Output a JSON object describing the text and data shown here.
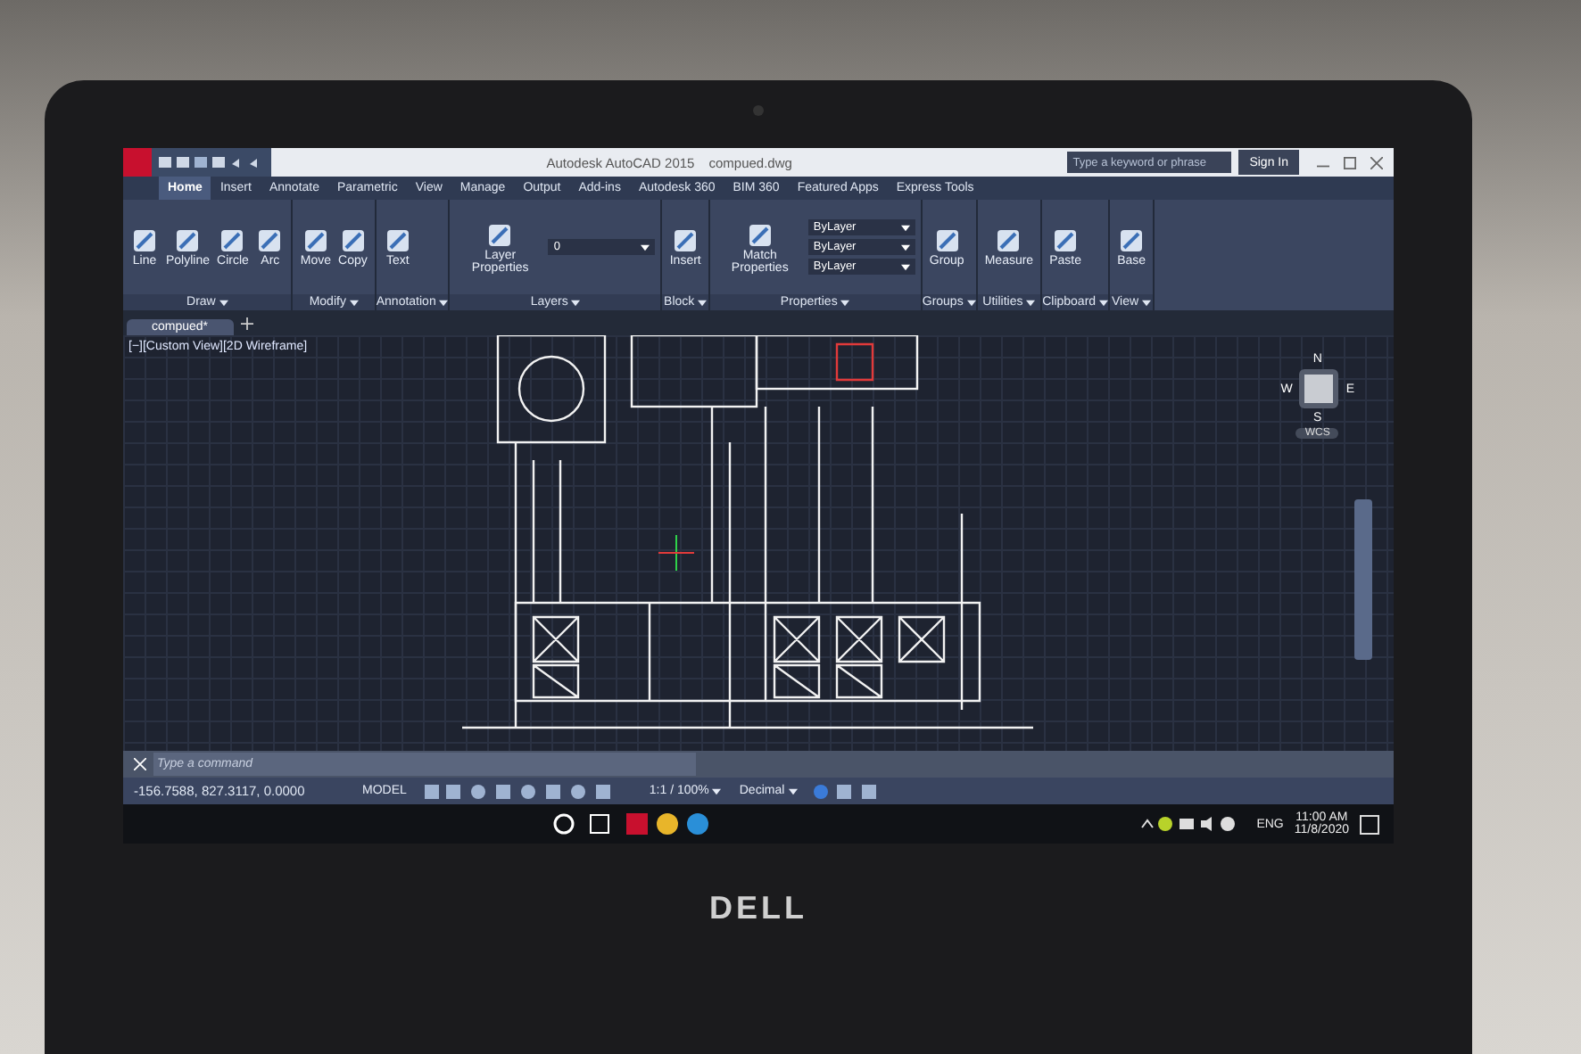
{
  "window": {
    "title": "Autodesk AutoCAD 2015",
    "file": "compued.dwg",
    "search_placeholder": "Type a keyword or phrase",
    "sign_in": "Sign In"
  },
  "ribbon_tabs": [
    {
      "label": "Home",
      "selected": true
    },
    {
      "label": "Insert",
      "selected": false
    },
    {
      "label": "Annotate",
      "selected": false
    },
    {
      "label": "Parametric",
      "selected": false
    },
    {
      "label": "View",
      "selected": false
    },
    {
      "label": "Manage",
      "selected": false
    },
    {
      "label": "Output",
      "selected": false
    },
    {
      "label": "Add-ins",
      "selected": false
    },
    {
      "label": "Autodesk 360",
      "selected": false
    },
    {
      "label": "BIM 360",
      "selected": false
    },
    {
      "label": "Featured Apps",
      "selected": false
    },
    {
      "label": "Express Tools",
      "selected": false
    }
  ],
  "panels": [
    {
      "title": "Draw",
      "tools": [
        "Line",
        "Polyline",
        "Circle",
        "Arc"
      ]
    },
    {
      "title": "Modify",
      "tools": [
        "Move",
        "Copy"
      ]
    },
    {
      "title": "Annotation",
      "tools": [
        "Text"
      ]
    },
    {
      "title": "Layers",
      "tools": [
        "Layer Properties"
      ],
      "dropdowns": [
        "0"
      ]
    },
    {
      "title": "Block",
      "tools": [
        "Insert"
      ]
    },
    {
      "title": "Properties",
      "tools": [
        "Match Properties"
      ],
      "dropdowns": [
        "ByLayer",
        "ByLayer",
        "ByLayer"
      ]
    },
    {
      "title": "Groups",
      "tools": [
        "Group"
      ]
    },
    {
      "title": "Utilities",
      "tools": [
        "Measure"
      ]
    },
    {
      "title": "Clipboard",
      "tools": [
        "Paste"
      ]
    },
    {
      "title": "View",
      "tools": [
        "Base"
      ]
    }
  ],
  "document_tabs": [
    {
      "label": "compued*",
      "selected": true
    }
  ],
  "viewport": {
    "label": "[−][Custom View][2D Wireframe]"
  },
  "viewcube": {
    "directions": [
      "N",
      "E",
      "S",
      "W"
    ],
    "ucs": "WCS"
  },
  "command_line": {
    "placeholder": "Type a command"
  },
  "status_bar": {
    "coordinates": "-156.7588, 827.3117, 0.0000",
    "model": "MODEL",
    "scale": "1:1 / 100%",
    "units": "Decimal"
  },
  "taskbar": {
    "language": "ENG",
    "time": "11:00 AM",
    "date": "11/8/2020"
  },
  "laptop": {
    "brand": "DELL"
  }
}
